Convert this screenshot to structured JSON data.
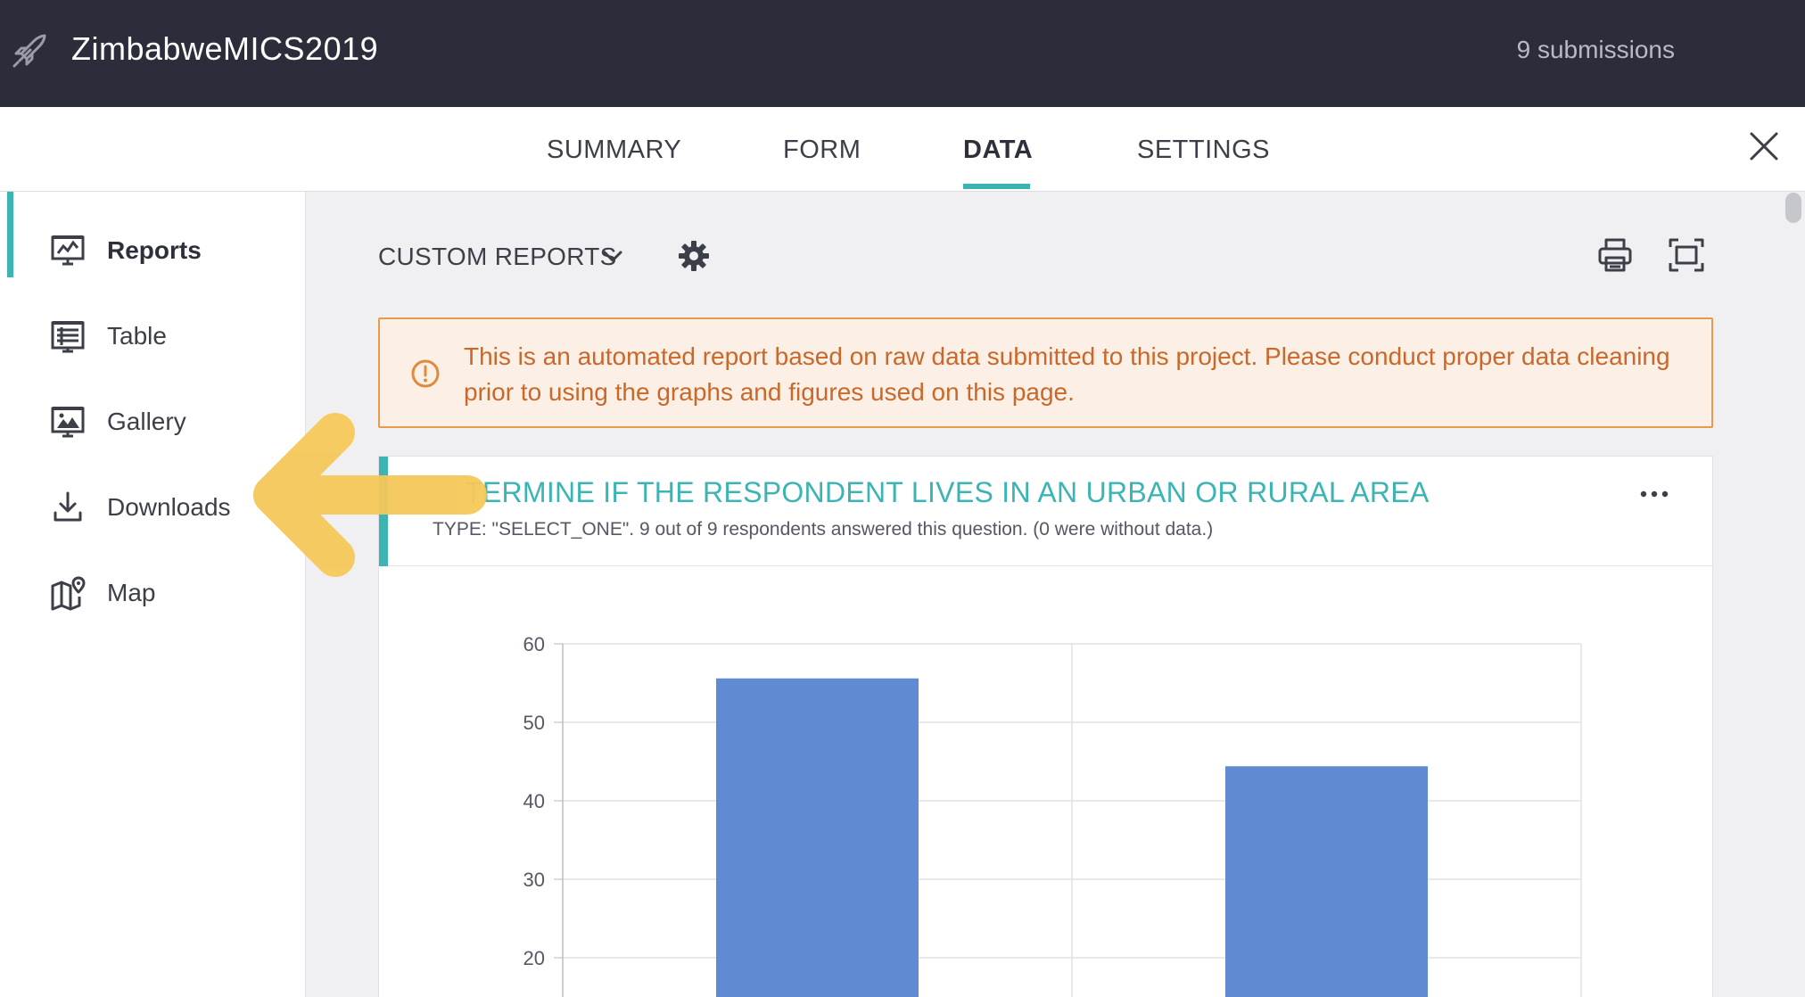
{
  "app": {
    "title": "ZimbabweMICS2019",
    "submissions": "9 submissions"
  },
  "tabs": [
    {
      "label": "SUMMARY",
      "active": false
    },
    {
      "label": "FORM",
      "active": false
    },
    {
      "label": "DATA",
      "active": true
    },
    {
      "label": "SETTINGS",
      "active": false
    }
  ],
  "sidebar": {
    "items": [
      {
        "label": "Reports",
        "icon": "reports-icon",
        "active": true
      },
      {
        "label": "Table",
        "icon": "table-icon",
        "active": false
      },
      {
        "label": "Gallery",
        "icon": "gallery-icon",
        "active": false
      },
      {
        "label": "Downloads",
        "icon": "download-icon",
        "active": false
      },
      {
        "label": "Map",
        "icon": "map-icon",
        "active": false
      }
    ]
  },
  "toolbar": {
    "custom_reports": "CUSTOM REPORTS"
  },
  "warning": {
    "text": "This is an automated report based on raw data submitted to this project. Please conduct proper data cleaning prior to using the graphs and figures used on this page."
  },
  "card": {
    "title": "TERMINE IF THE RESPONDENT LIVES IN AN URBAN OR RURAL AREA",
    "meta": "TYPE: \"SELECT_ONE\". 9 out of 9 respondents answered this question. (0 were without data.)"
  },
  "colors": {
    "accent": "#3cb4b4",
    "topbar": "#2b2d3a",
    "bar": "#5b87d2",
    "warning_text": "#c9682a",
    "warning_bg": "#fcf0e6",
    "arrow": "#f5c85a"
  },
  "chart_data": {
    "type": "bar",
    "categories": [
      "",
      ""
    ],
    "values": [
      55.6,
      44.4
    ],
    "yticks": [
      60,
      50,
      40,
      30,
      20
    ],
    "ylim": [
      0,
      60
    ],
    "visible_ylim": [
      15,
      60
    ],
    "grid": true
  }
}
